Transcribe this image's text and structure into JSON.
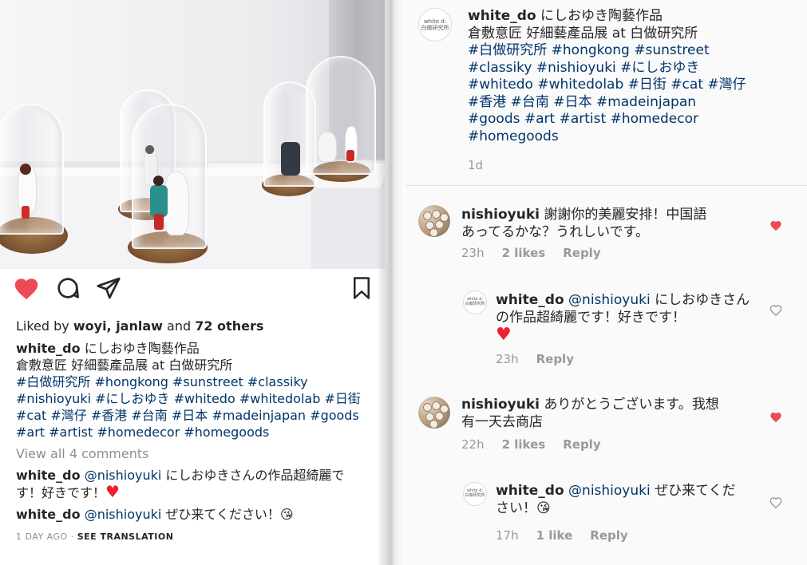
{
  "left": {
    "liked_prefix": "Liked by ",
    "liked_users": "woyi, janlaw",
    "liked_and": " and ",
    "liked_count": "72 others",
    "caption_user": "white_do",
    "caption_line1": " にしおゆき陶藝作品",
    "caption_line2": "倉敷意匠 好細藝產品展 at 白做研究所",
    "caption_tags_1": "#白做研究所 #hongkong #sunstreet #classiky",
    "caption_tags_2": "#nishioyuki #にしおゆき #whitedo #whitedolab #日街",
    "caption_tags_3": "#cat #灣仔 #香港 #台南 #日本 #madeinjapan #goods",
    "caption_tags_4": "#art #artist #homedecor #homegoods",
    "view_all": "View all 4 comments",
    "comment1_user": "white_do",
    "comment1_mention": " @nishioyuki",
    "comment1_text_a": " にしおゆきさんの作品超綺麗で",
    "comment1_text_b": "す！好きです！",
    "comment1_emoji": "♥",
    "comment2_user": "white_do",
    "comment2_mention": " @nishioyuki",
    "comment2_text": " ぜひ来てください！",
    "comment2_emoji": "😘",
    "time_label": "1 DAY AGO",
    "time_sep": " · ",
    "see_translation": "SEE TRANSLATION"
  },
  "right": {
    "avatar_text_1": "white d:",
    "avatar_text_2": "白做研究所",
    "post_user": "white_do",
    "post_line1": " にしおゆき陶藝作品",
    "post_line2": "倉敷意匠 好細藝產品展 at 白做研究所",
    "post_tags_1": "#白做研究所 #hongkong #sunstreet",
    "post_tags_2": "#classiky #nishioyuki #にしおゆき",
    "post_tags_3": "#whitedo #whitedolab #日街 #cat #灣仔",
    "post_tags_4": "#香港 #台南 #日本 #madeinjapan",
    "post_tags_5": "#goods #art #artist #homedecor",
    "post_tags_6": "#homegoods",
    "post_age": "1d",
    "comments": [
      {
        "user": "nishioyuki",
        "line1": " 謝謝你的美麗安排！中国語",
        "line2": "あってるかな？うれしいです。",
        "time": "23h",
        "likes": "2 likes",
        "reply": "Reply",
        "liked": true
      },
      {
        "user": "white_do",
        "mention": " @nishioyuki",
        "line1": " にしおゆきさん",
        "line2": "の作品超綺麗です！好きです！",
        "emoji": "♥",
        "time": "23h",
        "reply": "Reply",
        "liked": false
      },
      {
        "user": "nishioyuki",
        "line1": " ありがとうございます。我想",
        "line2": "有一天去商店",
        "time": "22h",
        "likes": "2 likes",
        "reply": "Reply",
        "liked": true
      },
      {
        "user": "white_do",
        "mention": " @nishioyuki",
        "line1": " ぜひ来てくだ",
        "line2": "さい！",
        "emoji": "😘",
        "time": "17h",
        "likes": "1 like",
        "reply": "Reply",
        "liked": false
      }
    ]
  },
  "colors": {
    "like_red": "#ed4956",
    "hashtag_blue": "#003569",
    "muted_gray": "#8e8e8e"
  }
}
